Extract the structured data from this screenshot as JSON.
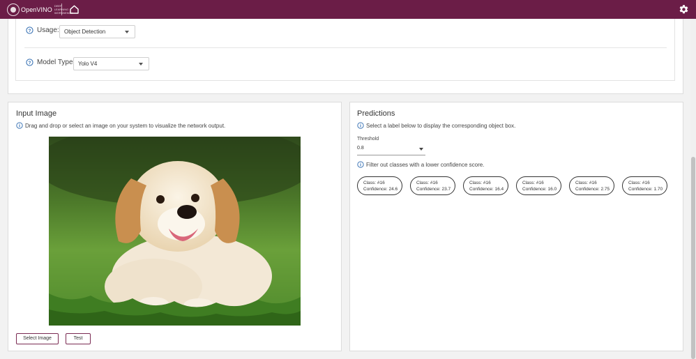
{
  "header": {
    "logo_text": "OpenVINO",
    "logo_subtext": "DEEP LEARNING WORKBENCH",
    "home_icon": "home-icon",
    "settings_icon": "gear-icon",
    "brand_color": "#6b1d47"
  },
  "config": {
    "usage_label": "Usage:",
    "usage_value": "Object Detection",
    "model_type_label": "Model Type:",
    "model_type_value": "Yolo V4"
  },
  "input_panel": {
    "title": "Input Image",
    "hint": "Drag and drop or select an image on your system to visualize the network output.",
    "select_button": "Select Image",
    "test_button": "Test"
  },
  "predictions_panel": {
    "title": "Predictions",
    "hint": "Select a label below to display the corresponding object box.",
    "threshold_label": "Threshold",
    "threshold_value": "0.8",
    "filter_hint": "Filter out classes with a lower confidence score.",
    "items": [
      {
        "class_text": "Class: #16",
        "confidence_text": "Confidence: 24.6"
      },
      {
        "class_text": "Class: #16",
        "confidence_text": "Confidence: 23.7"
      },
      {
        "class_text": "Class: #16",
        "confidence_text": "Confidence: 16.4"
      },
      {
        "class_text": "Class: #16",
        "confidence_text": "Confidence: 16.0"
      },
      {
        "class_text": "Class: #16",
        "confidence_text": "Confidence: 2.75"
      },
      {
        "class_text": "Class: #16",
        "confidence_text": "Confidence: 1.70"
      }
    ]
  }
}
